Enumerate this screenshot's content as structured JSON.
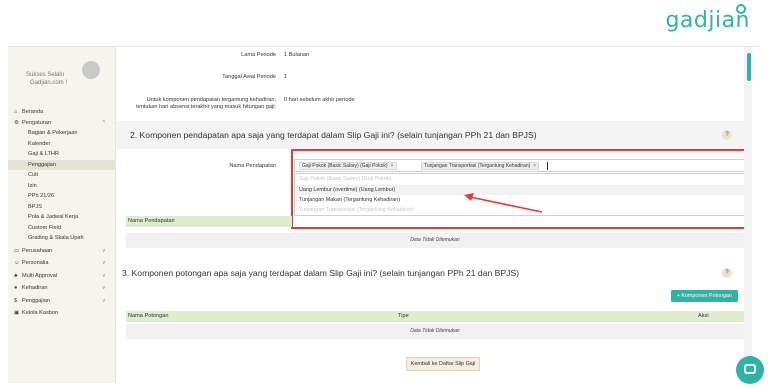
{
  "brand": {
    "logo_text": "gadjian"
  },
  "sidebar": {
    "profile_line1": "Sukses Selalu",
    "profile_line2": "Gadjian.com !",
    "items": [
      {
        "label": "Beranda",
        "icon": "home-icon"
      },
      {
        "label": "Pengaturan",
        "icon": "gear-icon",
        "expanded": true
      },
      {
        "label": "Bagian & Pekerjaan"
      },
      {
        "label": "Kalender"
      },
      {
        "label": "Gaji & LTHR"
      },
      {
        "label": "Penggajian",
        "active": true
      },
      {
        "label": "Cuti"
      },
      {
        "label": "Izin"
      },
      {
        "label": "PPh 21/26"
      },
      {
        "label": "BPJS"
      },
      {
        "label": "Pola & Jadwal Kerja"
      },
      {
        "label": "Custom Field"
      },
      {
        "label": "Grading & Skala Upah"
      },
      {
        "label": "Perusahaan",
        "icon": "folder-icon"
      },
      {
        "label": "Personalia",
        "icon": "person-icon"
      },
      {
        "label": "Multi Approval",
        "icon": "approval-icon"
      },
      {
        "label": "Kehadiran",
        "icon": "attendance-icon"
      },
      {
        "label": "Penggajian",
        "icon": "payroll-icon"
      },
      {
        "label": "Kelola Kasbon",
        "icon": "card-icon"
      }
    ]
  },
  "form": {
    "lama_periode_label": "Lama Periode",
    "lama_periode_value": "1 Bulanan",
    "tanggal_awal_label": "Tanggal Awal Periode",
    "tanggal_awal_value": "1",
    "komponen_note_line1": "Untuk komponen pendapatan tergantung kehadiran,",
    "komponen_note_line2": "tentukan hari absensi terakhir yang masuk hitungan gaji:",
    "komponen_note_value": "0 hari sebelum akhir periode"
  },
  "section2": {
    "title": "2. Komponen pendapatan apa saja yang terdapat dalam Slip Gaji ini? (selain tunjangan PPh 21 dan BPJS)",
    "help": "?",
    "field_label": "Nama Pendapatan",
    "chips": [
      "Gaji Pokok (Basic Salary) (Gaji Pokok)",
      "Tunjangan Transportasi (Tergantung Kehadiran)"
    ],
    "chip_remove": "×",
    "options": [
      {
        "label": "Gaji Pokok (Basic Salary) (Gaji Pokok)",
        "selected": true
      },
      {
        "label": "Uang Lembur (overtime) (Uang Lembur)",
        "selected": false,
        "highlighted": true
      },
      {
        "label": "Tunjangan Makan (Tergantung Kehadiran)",
        "selected": false
      },
      {
        "label": "Tunjangan Transportasi (Tergantung Kehadiran)",
        "selected": true
      }
    ],
    "table_header": "Nama Pendapatan",
    "empty_text": "Data Tidak Ditemukan"
  },
  "section3": {
    "title": "3. Komponen potongan apa saja yang terdapat dalam Slip Gaji ini? (selain tunjangan PPh 21 dan BPJS)",
    "help": "?",
    "add_button": "+ Komponen Potongan",
    "columns": [
      "Nama Potongan",
      "Tipe",
      "Aksi"
    ],
    "empty_text": "Data Tidak Ditemukan"
  },
  "footer": {
    "back_button": "Kembali ke Daftar Slip Gaji"
  },
  "colors": {
    "accent": "#2fb3a4",
    "highlight_border": "#e33a3a",
    "table_header": "#dfeccf"
  }
}
